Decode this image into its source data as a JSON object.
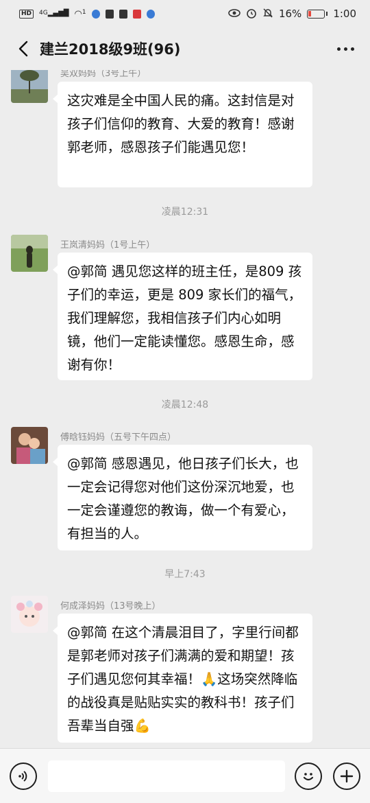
{
  "status_bar": {
    "network": "HD",
    "signal": "4G",
    "notification_count": "1",
    "battery": "16%",
    "time": "1:00"
  },
  "nav": {
    "title": "建兰2018级9班(96)"
  },
  "messages": [
    {
      "sender": "吴双妈妈（3号上午）",
      "text": "这灾难是全中国人民的痛。这封信是对孩子们信仰的教育、大爱的教育！感谢郭老师，感恩孩子们能遇见您！"
    },
    {
      "sender": "王岚清妈妈（1号上午）",
      "text": "@郭简 遇见您这样的班主任，是809 孩子们的幸运，更是 809 家长们的福气，我们理解您，我相信孩子们内心如明镜，他们一定能读懂您。感恩生命，感谢有你！"
    },
    {
      "sender": "傅晗钰妈妈（五号下午四点）",
      "text": "@郭简  感恩遇见，他日孩子们长大，也一定会记得您对他们这份深沉地爱，也一定会谨遵您的教诲，做一个有爱心，有担当的人。"
    },
    {
      "sender": "何成泽妈妈（13号晚上）",
      "text": "@郭简  在这个清晨泪目了，字里行间都是郭老师对孩子们满满的爱和期望！孩子们遇见您何其幸福！🙏这场突然降临的战役真是贴贴实实的教科书！孩子们吾辈当自强💪"
    }
  ],
  "timestamps": [
    "凌晨12:31",
    "凌晨12:48",
    "早上7:43"
  ],
  "colors": {
    "background": "#ededed",
    "bubble": "#ffffff",
    "meta_text": "#9a9a9a"
  }
}
